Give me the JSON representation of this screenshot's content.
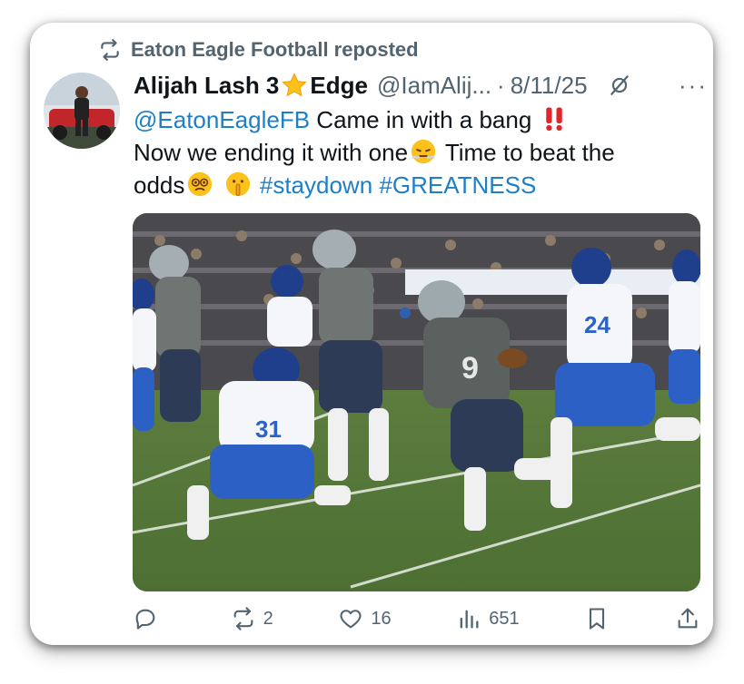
{
  "repost": {
    "label": "Eaton Eagle Football reposted",
    "icon": "repost-icon"
  },
  "author": {
    "name": "Alijah Lash 3",
    "name_suffix": "Edge",
    "handle": "@IamAlij...",
    "separator": "·",
    "date": "8/11/25",
    "more": "···"
  },
  "tweet": {
    "mention": "@EatonEagleFB",
    "line1_text": " Came in with a bang",
    "line2_text": "Now we ending it with one",
    "line2_end": " Time to beat the",
    "line3_text": "odds",
    "hashtag1": "#staydown",
    "hashtag2": "#GREATNESS"
  },
  "actions": {
    "replies": "",
    "reposts": "2",
    "likes": "16",
    "views": "651"
  },
  "colors": {
    "link": "#1d7fc8",
    "secondary_text": "#536471",
    "primary_text": "#0f1419"
  }
}
